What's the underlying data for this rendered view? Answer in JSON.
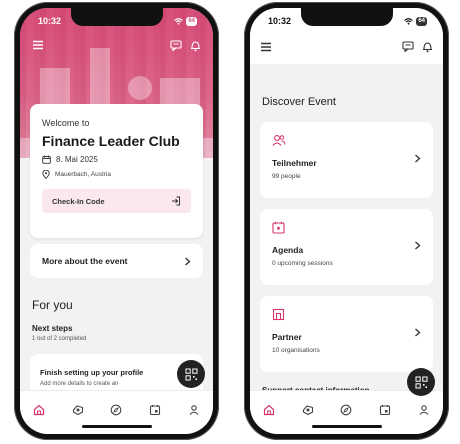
{
  "left": {
    "status": {
      "time": "10:32",
      "battery": "64"
    },
    "welcome": {
      "label": "Welcome to",
      "title": "Finance Leader Club",
      "date": "8. Mai 2025",
      "location": "Mauerbach, Austria",
      "checkin_label": "Check-In Code"
    },
    "more_about": "More about the event",
    "for_you": "For you",
    "next_steps": {
      "title": "Next steps",
      "subtitle": "1 out of 2 completed"
    },
    "profile": {
      "title": "Finish setting up your profile",
      "subtitle": "Add more details to create an"
    }
  },
  "right": {
    "status": {
      "time": "10:32",
      "battery": "64"
    },
    "discover_title": "Discover Event",
    "cards": [
      {
        "title": "Teilnehmer",
        "subtitle": "99 people",
        "icon": "people-icon"
      },
      {
        "title": "Agenda",
        "subtitle": "0 upcoming sessions",
        "icon": "calendar-icon"
      },
      {
        "title": "Partner",
        "subtitle": "10 organisations",
        "icon": "building-icon"
      }
    ],
    "support": "Support contact information"
  },
  "colors": {
    "accent": "#d6336c",
    "hero": "#d95f86",
    "fab": "#222222",
    "checkin_bg": "#fbe8ee"
  },
  "nav_icons": [
    "home-icon",
    "badge-icon",
    "compass-icon",
    "agenda-icon",
    "profile-icon"
  ]
}
